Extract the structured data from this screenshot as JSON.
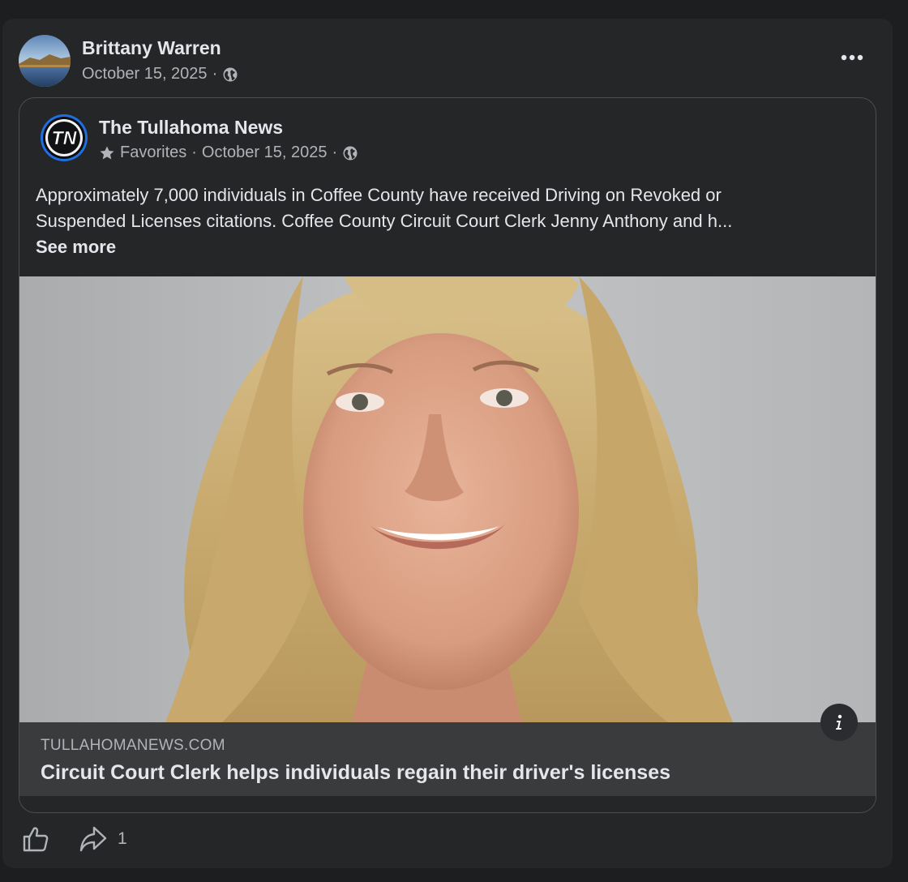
{
  "post": {
    "author": "Brittany Warren",
    "date": "October 15, 2025",
    "separator": "·",
    "privacy_icon": "globe-icon",
    "more_icon": "more-options-icon"
  },
  "shared_post": {
    "page_name": "The Tullahoma News",
    "logo_text": "TN",
    "favorites_label": "Favorites",
    "favorites_icon": "star-icon",
    "date": "October 15, 2025",
    "separator": "·",
    "privacy_icon": "globe-icon",
    "text_lines": [
      "Approximately 7,000 individuals in Coffee County have received Driving on Revoked or",
      "Suspended Licenses citations. Coffee County Circuit Court Clerk Jenny Anthony and h..."
    ],
    "see_more": "See more"
  },
  "link_preview": {
    "domain": "TULLAHOMANEWS.COM",
    "headline": "Circuit Court Clerk helps individuals regain their driver's licenses",
    "info_icon": "info-icon"
  },
  "actions": {
    "like_icon": "thumbs-up-icon",
    "share_icon": "share-icon",
    "share_count": "1"
  },
  "colors": {
    "background": "#1c1e20",
    "card": "#242628",
    "link_footer": "#3a3b3c",
    "primary_text": "#e4e6eb",
    "secondary_text": "#b0b3b8",
    "logo_ring": "#1f6fe0"
  }
}
